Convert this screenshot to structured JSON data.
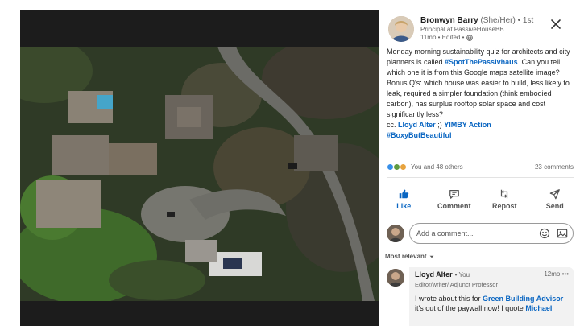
{
  "image": {
    "alt_icon": "satellite-image"
  },
  "author": {
    "name": "Bronwyn Barry",
    "pronouns": "(She/Her)",
    "degree": "• 1st",
    "headline": "Principal at PassiveHouseBB",
    "time": "11mo • Edited •",
    "visibility_icon": "globe-icon"
  },
  "post": {
    "line1": "Monday morning sustainability quiz for architects and city planners is called ",
    "tag1": "#SpotThePassivhaus",
    "line2": ". Can you tell which one it is from this Google maps satellite image?",
    "line3": "Bonus Q's: which house was easier to build, less likely to leak, required a simpler foundation (think embodied carbon), has surplus rooftop solar space and cost significantly less?",
    "cc_prefix": "cc. ",
    "mention1": "Lloyd Alter",
    "cc_mid": " ;) ",
    "mention2": "YIMBY Action",
    "tag2": "#BoxyButBeautiful"
  },
  "reactions": {
    "summary": "You and 48 others",
    "comments": "23 comments"
  },
  "actions": {
    "like": "Like",
    "comment": "Comment",
    "repost": "Repost",
    "send": "Send"
  },
  "comment_box": {
    "placeholder": "Add a comment..."
  },
  "sort": {
    "label": "Most relevant"
  },
  "comments": [
    {
      "name": "Lloyd Alter",
      "you": "• You",
      "time": "12mo",
      "more": "•••",
      "headline": "Editor/writer/ Adjunct Professor",
      "text_pre": "I wrote about this for ",
      "link1": "Green Building Advisor",
      "text_mid": " it's out of the paywall now! I quote ",
      "link2": "Michael"
    }
  ],
  "colors": {
    "accent": "#0a66c2",
    "viewer_bg": "#1c1c1c"
  }
}
